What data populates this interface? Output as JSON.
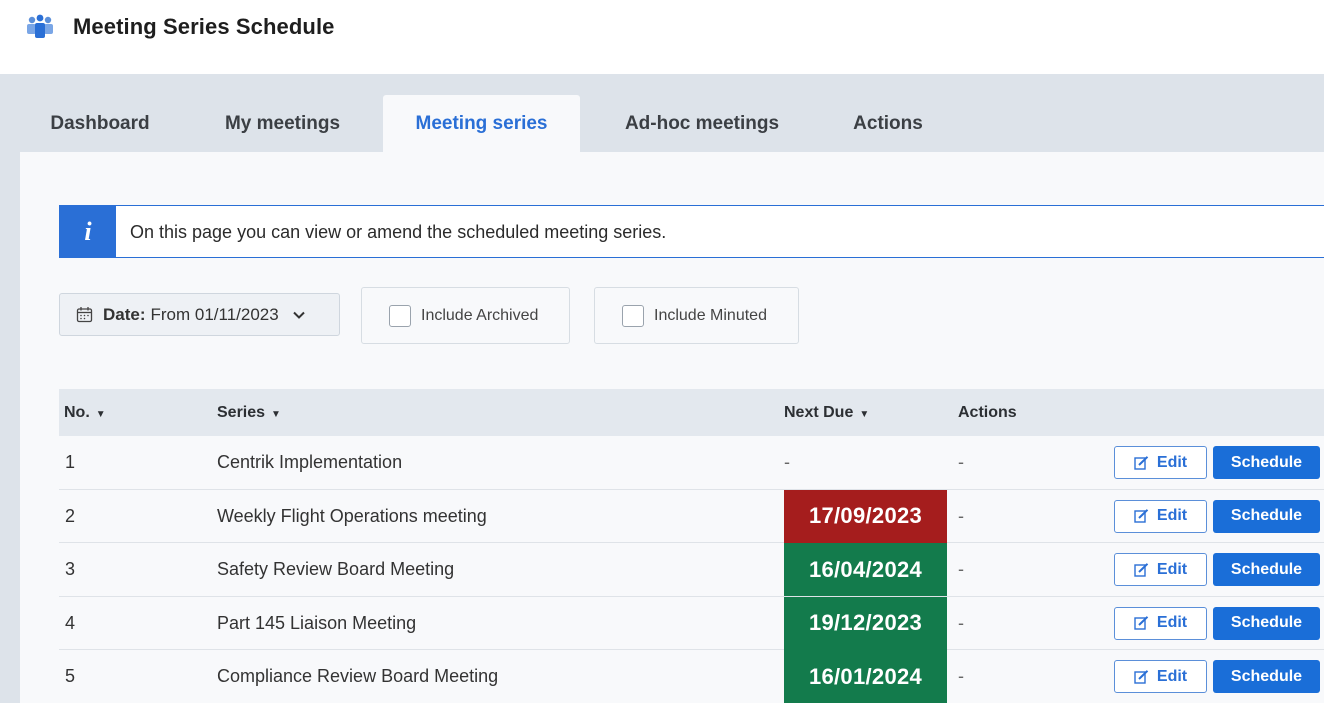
{
  "app": {
    "title": "Meeting Series Schedule",
    "logo_icon": "people-group-icon"
  },
  "tabs": [
    {
      "label": "Dashboard",
      "active": false
    },
    {
      "label": "My meetings",
      "active": false
    },
    {
      "label": "Meeting series",
      "active": true
    },
    {
      "label": "Ad-hoc meetings",
      "active": false
    },
    {
      "label": "Actions",
      "active": false
    }
  ],
  "info": {
    "icon": "info-icon",
    "text": "On this page you can view or amend the scheduled meeting series."
  },
  "filters": {
    "date": {
      "label": "Date:",
      "value": "From 01/11/2023",
      "icon": "calendar-icon"
    },
    "include_archived": {
      "label": "Include Archived",
      "checked": false
    },
    "include_minuted": {
      "label": "Include Minuted",
      "checked": false
    }
  },
  "table": {
    "headers": {
      "no": "No.",
      "series": "Series",
      "next_due": "Next Due",
      "actions": "Actions"
    },
    "edit_label": "Edit",
    "schedule_label": "Schedule",
    "rows": [
      {
        "no": "1",
        "series": "Centrik Implementation",
        "next_due": "-",
        "due_status": "none",
        "actions": "-"
      },
      {
        "no": "2",
        "series": "Weekly Flight Operations meeting",
        "next_due": "17/09/2023",
        "due_status": "overdue",
        "actions": "-"
      },
      {
        "no": "3",
        "series": "Safety Review Board Meeting",
        "next_due": "16/04/2024",
        "due_status": "ok",
        "actions": "-"
      },
      {
        "no": "4",
        "series": "Part 145 Liaison Meeting",
        "next_due": "19/12/2023",
        "due_status": "ok",
        "actions": "-"
      },
      {
        "no": "5",
        "series": "Compliance Review Board Meeting",
        "next_due": "16/01/2024",
        "due_status": "ok",
        "actions": "-"
      }
    ]
  },
  "colors": {
    "accent": "#2a6fd6",
    "overdue": "#a51d1d",
    "ok": "#137b4c"
  }
}
